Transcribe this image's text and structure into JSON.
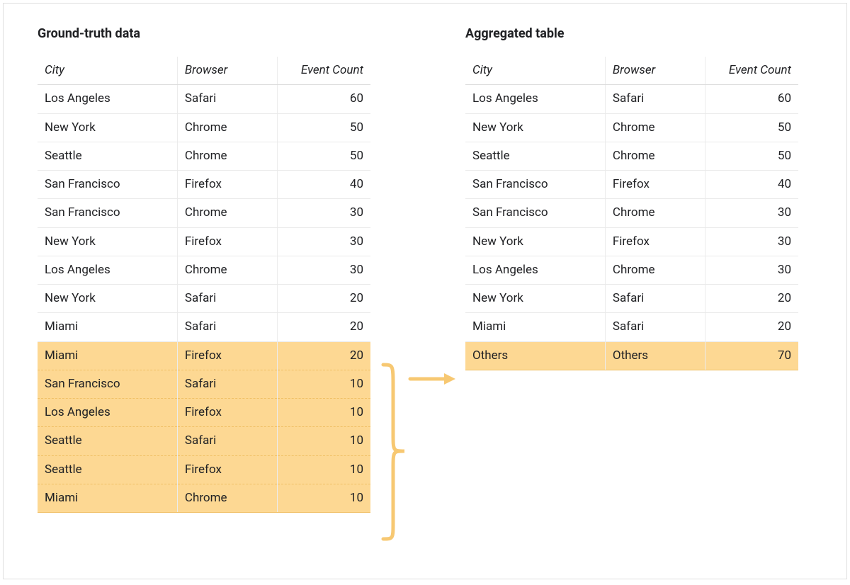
{
  "left": {
    "title": "Ground-truth data",
    "headers": {
      "city": "City",
      "browser": "Browser",
      "event_count": "Event Count"
    },
    "rows": [
      {
        "city": "Los Angeles",
        "browser": "Safari",
        "event_count": 60,
        "highlighted": false
      },
      {
        "city": "New York",
        "browser": "Chrome",
        "event_count": 50,
        "highlighted": false
      },
      {
        "city": "Seattle",
        "browser": "Chrome",
        "event_count": 50,
        "highlighted": false
      },
      {
        "city": "San Francisco",
        "browser": "Firefox",
        "event_count": 40,
        "highlighted": false
      },
      {
        "city": "San Francisco",
        "browser": "Chrome",
        "event_count": 30,
        "highlighted": false
      },
      {
        "city": "New York",
        "browser": "Firefox",
        "event_count": 30,
        "highlighted": false
      },
      {
        "city": "Los Angeles",
        "browser": "Chrome",
        "event_count": 30,
        "highlighted": false
      },
      {
        "city": "New York",
        "browser": "Safari",
        "event_count": 20,
        "highlighted": false
      },
      {
        "city": "Miami",
        "browser": "Safari",
        "event_count": 20,
        "highlighted": false
      },
      {
        "city": "Miami",
        "browser": "Firefox",
        "event_count": 20,
        "highlighted": true
      },
      {
        "city": "San Francisco",
        "browser": "Safari",
        "event_count": 10,
        "highlighted": true
      },
      {
        "city": "Los Angeles",
        "browser": "Firefox",
        "event_count": 10,
        "highlighted": true
      },
      {
        "city": "Seattle",
        "browser": "Safari",
        "event_count": 10,
        "highlighted": true
      },
      {
        "city": "Seattle",
        "browser": "Firefox",
        "event_count": 10,
        "highlighted": true
      },
      {
        "city": "Miami",
        "browser": "Chrome",
        "event_count": 10,
        "highlighted": true
      }
    ]
  },
  "right": {
    "title": "Aggregated table",
    "headers": {
      "city": "City",
      "browser": "Browser",
      "event_count": "Event Count"
    },
    "rows": [
      {
        "city": "Los Angeles",
        "browser": "Safari",
        "event_count": 60,
        "highlighted": false
      },
      {
        "city": "New York",
        "browser": "Chrome",
        "event_count": 50,
        "highlighted": false
      },
      {
        "city": "Seattle",
        "browser": "Chrome",
        "event_count": 50,
        "highlighted": false
      },
      {
        "city": "San Francisco",
        "browser": "Firefox",
        "event_count": 40,
        "highlighted": false
      },
      {
        "city": "San Francisco",
        "browser": "Chrome",
        "event_count": 30,
        "highlighted": false
      },
      {
        "city": "New York",
        "browser": "Firefox",
        "event_count": 30,
        "highlighted": false
      },
      {
        "city": "Los Angeles",
        "browser": "Chrome",
        "event_count": 30,
        "highlighted": false
      },
      {
        "city": "New York",
        "browser": "Safari",
        "event_count": 20,
        "highlighted": false
      },
      {
        "city": "Miami",
        "browser": "Safari",
        "event_count": 20,
        "highlighted": false
      },
      {
        "city": "Others",
        "browser": "Others",
        "event_count": 70,
        "highlighted": true
      }
    ]
  },
  "colors": {
    "highlight": "#fdd893",
    "brace": "#f7c872",
    "arrow": "#f7c872"
  }
}
